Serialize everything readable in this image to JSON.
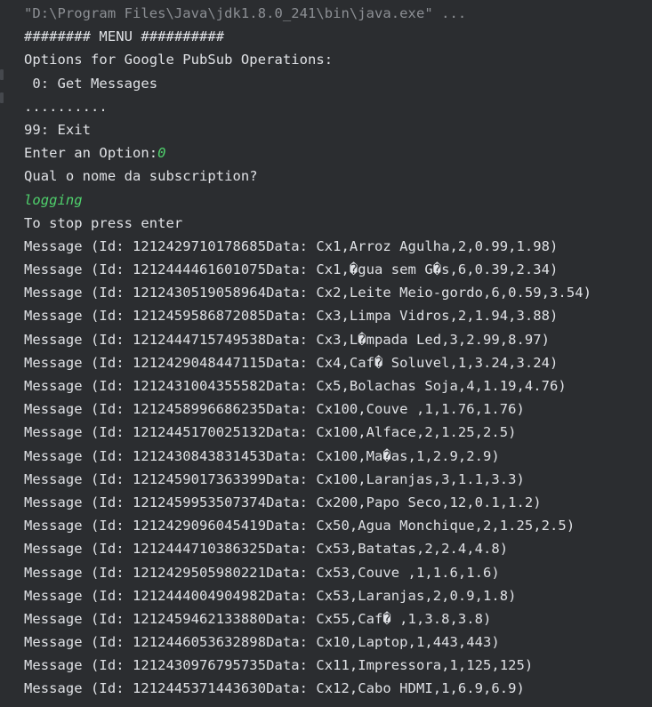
{
  "console": {
    "command": "\"D:\\Program Files\\Java\\jdk1.8.0_241\\bin\\java.exe\" ...",
    "menu_header": "######## MENU ##########",
    "options_title": "Options for Google PubSub Operations:",
    "option_get": " 0: Get Messages",
    "dots": "..........",
    "option_exit": "99: Exit",
    "enter_prompt": "Enter an Option:",
    "enter_value": "0",
    "subscription_prompt": "Qual o nome da subscription?",
    "subscription_value": "logging",
    "stop_hint": "To stop press enter",
    "messages": [
      "Message (Id: 1212429710178685Data: Cx1,Arroz Agulha,2,0.99,1.98)",
      "Message (Id: 1212444461601075Data: Cx1,�gua sem G�s,6,0.39,2.34)",
      "Message (Id: 1212430519058964Data: Cx2,Leite Meio-gordo,6,0.59,3.54)",
      "Message (Id: 1212459586872085Data: Cx3,Limpa Vidros,2,1.94,3.88)",
      "Message (Id: 1212444715749538Data: Cx3,L�mpada Led,3,2.99,8.97)",
      "Message (Id: 1212429048447115Data: Cx4,Caf� Soluvel,1,3.24,3.24)",
      "Message (Id: 1212431004355582Data: Cx5,Bolachas Soja,4,1.19,4.76)",
      "Message (Id: 1212458996686235Data: Cx100,Couve ,1,1.76,1.76)",
      "Message (Id: 1212445170025132Data: Cx100,Alface,2,1.25,2.5)",
      "Message (Id: 1212430843831453Data: Cx100,Ma�as,1,2.9,2.9)",
      "Message (Id: 1212459017363399Data: Cx100,Laranjas,3,1.1,3.3)",
      "Message (Id: 1212459953507374Data: Cx200,Papo Seco,12,0.1,1.2)",
      "Message (Id: 1212429096045419Data: Cx50,Agua Monchique,2,1.25,2.5)",
      "Message (Id: 1212444710386325Data: Cx53,Batatas,2,2.4,4.8)",
      "Message (Id: 1212429505980221Data: Cx53,Couve ,1,1.6,1.6)",
      "Message (Id: 1212444004904982Data: Cx53,Laranjas,2,0.9,1.8)",
      "Message (Id: 1212459462133880Data: Cx55,Caf� ,1,3.8,3.8)",
      "Message (Id: 1212446053632898Data: Cx10,Laptop,1,443,443)",
      "Message (Id: 1212430976795735Data: Cx11,Impressora,1,125,125)",
      "Message (Id: 1212445371443630Data: Cx12,Cabo HDMI,1,6.9,6.9)"
    ]
  },
  "colors": {
    "background": "#2b2d30",
    "text": "#dfe1e5",
    "command": "#8c8f94",
    "user_input": "#4fd16c"
  }
}
